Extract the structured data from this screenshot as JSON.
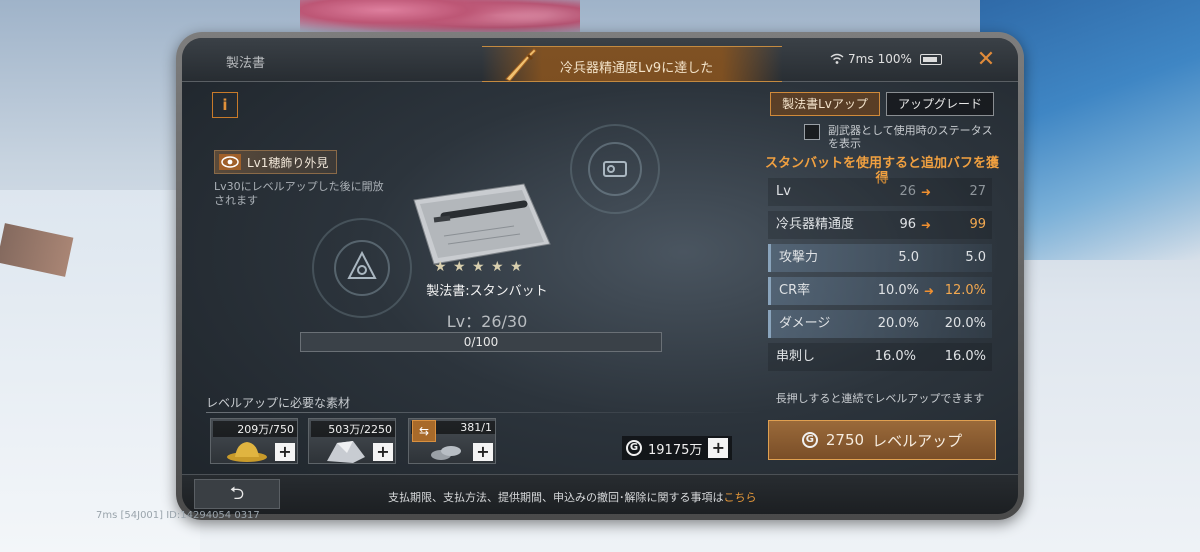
{
  "window": {
    "title": "製法書"
  },
  "achievement": {
    "text": "冷兵器精通度Lv9に達した"
  },
  "status": {
    "ping": "7ms",
    "battery": "100%"
  },
  "unlock": {
    "label": "Lv1穂飾り外見",
    "description": "Lv30にレベルアップした後に開放されます"
  },
  "item": {
    "name": "製法書:スタンバット",
    "stars": 5,
    "level_text": "Lv：26/30",
    "exp_text": "0/100",
    "exp_progress": 0
  },
  "tabs": {
    "active": "製法書Lvアップ",
    "inactive": "アップグレード"
  },
  "sub_weapon_label": "副武器として使用時のステータスを表示",
  "buff_note": "スタンバットを使用すると追加バフを獲得",
  "stats": [
    {
      "label": "Lv",
      "current": "26",
      "next": "27",
      "up": false,
      "arrow": true,
      "highlight": false
    },
    {
      "label": "冷兵器精通度",
      "current": "96",
      "next": "99",
      "up": true,
      "arrow": true,
      "highlight": false
    },
    {
      "label": "攻撃力",
      "current": "5.0",
      "next": "5.0",
      "up": false,
      "arrow": false,
      "highlight": true
    },
    {
      "label": "CR率",
      "current": "10.0%",
      "next": "12.0%",
      "up": true,
      "arrow": true,
      "highlight": true
    },
    {
      "label": "ダメージ",
      "current": "20.0%",
      "next": "20.0%",
      "up": false,
      "arrow": false,
      "highlight": true
    },
    {
      "label": "串刺し",
      "current": "16.0%",
      "next": "16.0%",
      "up": false,
      "arrow": false,
      "highlight": false
    }
  ],
  "hold_note": "長押しすると連続でレベルアップできます",
  "levelup_button": {
    "cost": "2750",
    "label": "レベルアップ"
  },
  "materials": {
    "label": "レベルアップに必要な素材",
    "items": [
      {
        "count": "209万/750",
        "icon": "gold-hat-icon"
      },
      {
        "count": "503万/2250",
        "icon": "silver-ore-icon"
      },
      {
        "count": "381/1",
        "icon": "coins-icon"
      }
    ]
  },
  "currency": {
    "amount": "19175万"
  },
  "legal": {
    "text": "支払期限、支払方法、提供期間、申込みの撤回･解除に関する事項は",
    "link": "こちら"
  },
  "overlay": {
    "text": "7ms  [54J001] ID:14294054 0317"
  },
  "colors": {
    "accent": "#e8983a",
    "highlight_row": "#5a6e82",
    "up_value": "#f2a850"
  }
}
